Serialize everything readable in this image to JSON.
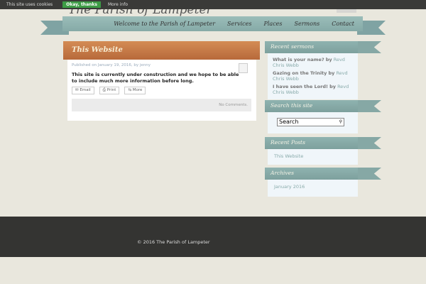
{
  "cookie": {
    "text": "This site uses cookies",
    "ok": "Okay, thanks",
    "more": "More info"
  },
  "site_title": "The Parish of Lampeter",
  "nav": [
    "Welcome to the Parish of Lampeter",
    "Services",
    "Places",
    "Sermons",
    "Contact"
  ],
  "post": {
    "title": "This Website",
    "meta": "Published on January 19, 2016, by jenny",
    "body": "This site is currently under construction and we hope to be able to include much more information before long.",
    "share": [
      "✉ Email",
      "⎙ Print",
      "⇆ More"
    ],
    "comments": "No Comments."
  },
  "sidebar": {
    "sermons_title": "Recent sermons",
    "sermons": [
      {
        "t": "What is your name?",
        "a": "Revd Chris Webb"
      },
      {
        "t": "Gazing on the Trinity",
        "a": "Revd Chris Webb"
      },
      {
        "t": "I have seen the Lord!",
        "a": "Revd Chris Webb"
      }
    ],
    "by": "by",
    "search_title": "Search this site",
    "search_placeholder": "Search",
    "posts_title": "Recent Posts",
    "posts": [
      "This Website"
    ],
    "archives_title": "Archives",
    "archives": [
      "January 2016"
    ]
  },
  "footer": "© 2016 The Parish of Lampeter"
}
